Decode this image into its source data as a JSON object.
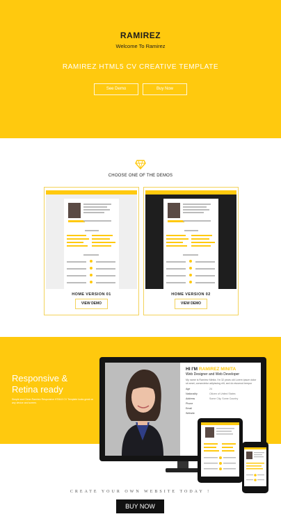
{
  "hero": {
    "brand": "RAMIREZ",
    "welcome": "Welcome To Ramirez",
    "tagline": "RAMIREZ HTML5 CV CREATIVE TEMPLATE",
    "demo_button": "See Demo",
    "buy_button": "Buy Now"
  },
  "demos": {
    "icon": "diamond-icon",
    "heading": "CHOOSE ONE OF THE DEMOS",
    "cards": [
      {
        "title": "HOME VERSION 01",
        "button": "VIEW DEMO"
      },
      {
        "title": "HOME VERSION 02",
        "button": "VIEW DEMO"
      }
    ]
  },
  "promo": {
    "heading": "Responsive & Retina ready",
    "description": "Simple and Clean Ramirez Responsive HTML5 CV Template looks great on any device and screen.",
    "preview": {
      "greeting": "HI I'M",
      "name": "RAMIREZ MINITA",
      "role": "Web Designer and Web Developer",
      "bio": "My name is Ramirez Minita. I'm 32 years old Lorem ipsum dolor sit amet, consectetur adipiscing elit, sed do eiusmod tempor",
      "fields": [
        {
          "label": "Age",
          "value": "24"
        },
        {
          "label": "Nationality",
          "value": "Citizen of United States"
        },
        {
          "label": "Address",
          "value": "Some City, Some Country"
        },
        {
          "label": "Phone",
          "value": ""
        },
        {
          "label": "Email",
          "value": ""
        },
        {
          "label": "Website",
          "value": ""
        }
      ]
    },
    "cta_text": "CREATE YOUR OWN WEBSITE TODAY !",
    "cta_button": "BUY NOW"
  },
  "colors": {
    "accent": "#ffc90e",
    "dark": "#111111",
    "white": "#ffffff"
  }
}
